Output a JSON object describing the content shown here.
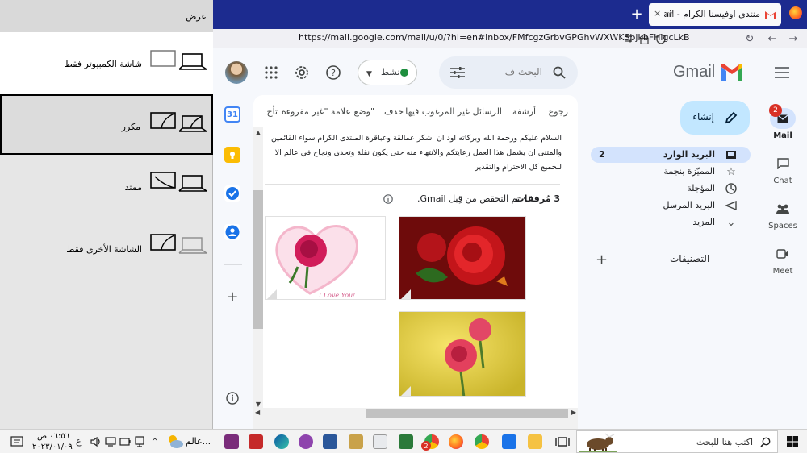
{
  "browser": {
    "tab_title": "منتدى اوفيسنا الكرام - Gmail",
    "tab_title_fragment": "m",
    "url": "https://mail.google.com/mail/u/0/?hl=en#inbox/FMfcgzGrbvGPGhvWXWKSbjkbFHlgcLkB",
    "new_tab": "+",
    "close": "×"
  },
  "gmail": {
    "logo_text": "Gmail",
    "search_placeholder": "البحث ف",
    "status_label": "نشط",
    "compose_label": "إنشاء",
    "nav": [
      {
        "label": "البريد الوارد",
        "count": "2"
      },
      {
        "label": "المميّزة بنجمة",
        "count": ""
      },
      {
        "label": "المؤجلة",
        "count": ""
      },
      {
        "label": "البريد المرسل",
        "count": ""
      },
      {
        "label": "المزيد",
        "count": ""
      }
    ],
    "labels_heading": "التصنيفات",
    "rail": [
      {
        "label": "Mail",
        "badge": "2"
      },
      {
        "label": "Chat"
      },
      {
        "label": "Spaces"
      },
      {
        "label": "Meet"
      }
    ],
    "toolbar": [
      "رجوع",
      "أرشفة",
      "الرسائل غير المرغوب فيها",
      "حذف",
      "وضع علامة \"غير مقروءة\"",
      "تأج"
    ],
    "message_lines": [
      "السلام عليكم ورحمة الله وبركاته اود ان اشكر عمالقة وعباقرة المنتدى الكرام سواء القائمين",
      "والمتنى ان يشمل هذا العمل رعايتكم والانتهاء منه حتى يكون نقلة وتحدى ونجاح في عالم الا",
      "للجميع كل الاحترام والتقدير"
    ],
    "attachments_count": "3 مُرفقات",
    "attachments_note": "• تم التحقص من قِبل Gmail.",
    "image_caption": "I Love You!"
  },
  "projection": {
    "title": "عرض",
    "options": [
      "شاشة الكمبيوتر فقط",
      "مكرر",
      "ممتد",
      "الشاشة الأخرى فقط"
    ]
  },
  "taskbar": {
    "search_text": "اكتب هنا للبحث",
    "weather_text": "عالم...",
    "clock_time": "٠٦:٥٦ ص",
    "clock_date": "٢٠٢٣/٠١/٠٩",
    "lang": "ع",
    "chrome_badge": "2"
  }
}
